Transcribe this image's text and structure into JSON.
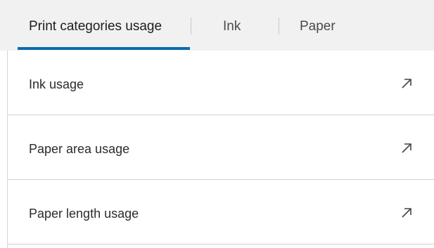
{
  "tabs": [
    {
      "label": "Print categories usage",
      "active": true
    },
    {
      "label": "Ink",
      "active": false
    },
    {
      "label": "Paper",
      "active": false
    }
  ],
  "list": {
    "items": [
      {
        "label": "Ink usage",
        "icon": "external-arrow-icon"
      },
      {
        "label": "Paper area usage",
        "icon": "external-arrow-icon"
      },
      {
        "label": "Paper length usage",
        "icon": "external-arrow-icon"
      }
    ]
  },
  "colors": {
    "accent": "#0a6bb0",
    "tabbar_bg": "#f1f1f1",
    "divider": "#d0d0d0",
    "text": "#2b2b2b"
  }
}
